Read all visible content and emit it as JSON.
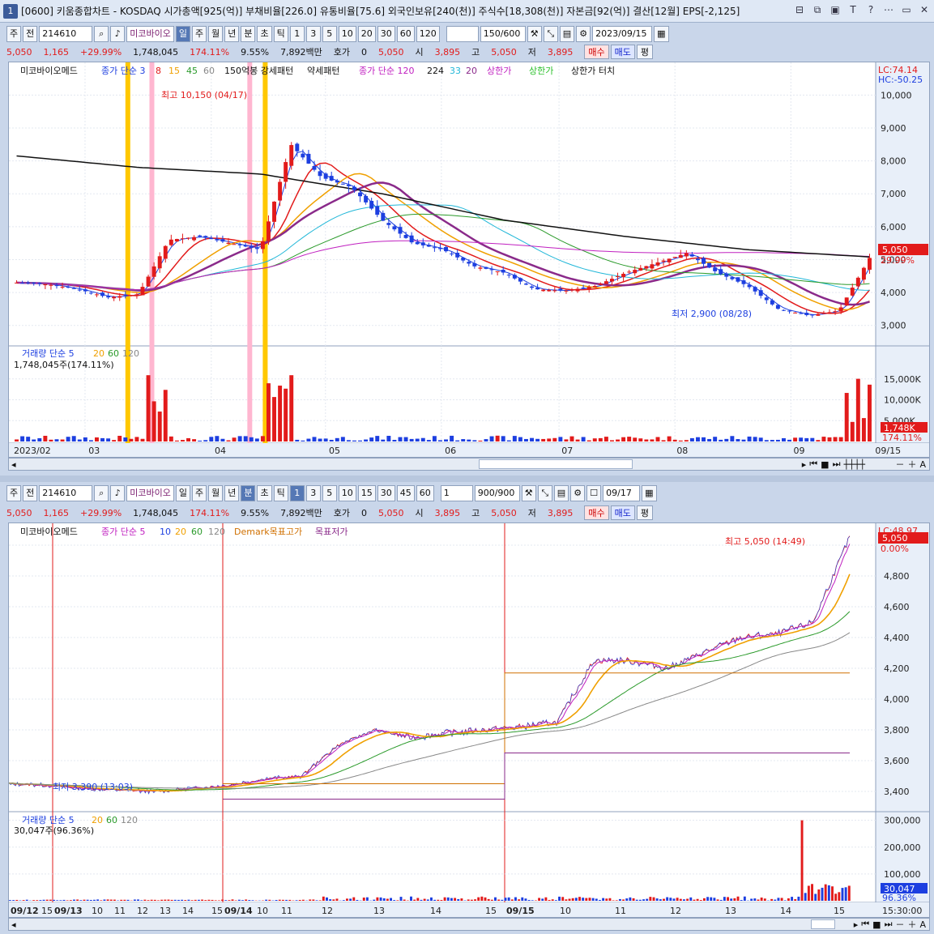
{
  "window": {
    "number": "1",
    "title": "[0600] 키움종합차트 - KOSDAQ 시가총액[925(억)] 부채비율[226.0] 유통비율[75.6] 외국인보유[240(천)] 주식수[18,308(천)] 자본금[92(억)] 결산[12월] EPS[-2,125]",
    "buttons": [
      "⊟",
      "⧉",
      "▣",
      "T",
      "?",
      "⋯",
      "▭",
      "✕"
    ]
  },
  "top": {
    "toolbar": {
      "type": "주",
      "prev": "전",
      "code": "214610",
      "name": "미코바이오",
      "periods": [
        "일",
        "주",
        "월",
        "년",
        "분",
        "초",
        "틱"
      ],
      "active_period": "일",
      "counts": [
        "1",
        "3",
        "5",
        "10",
        "20",
        "30",
        "60",
        "120"
      ],
      "range": "150/600",
      "date": "2023/09/15"
    },
    "info": {
      "price": "5,050",
      "change": "1,165",
      "pct": "+29.99%",
      "volume": "1,748,045",
      "vol_pct": "174.11%",
      "turnover": "9.55%",
      "amount": "7,892백만",
      "quote_label": "호가",
      "quote_val": "0",
      "quote_price": "5,050",
      "open_label": "시",
      "open": "3,895",
      "high_label": "고",
      "high": "5,050",
      "low_label": "저",
      "low": "3,895",
      "buy": "매수",
      "sell": "매도",
      "avg": "평"
    },
    "legend": [
      "미코바이오메드",
      "종가 단순 3",
      "8",
      "15",
      "45",
      "60",
      "150억봉 강세패턴",
      "약세패턴",
      "종가 단순 120",
      "224",
      "33",
      "20",
      "상한가",
      "상한가",
      "상한가 터치"
    ],
    "right_top": [
      "LC:74.14",
      "HC:-50.25"
    ],
    "hi_label": "최고 10,150 (04/17)",
    "lo_label": "최저 2,900 (08/28)",
    "price_badge": "5,050",
    "pct_badge": "29.99%",
    "vol_legend": [
      "거래량 단순 5",
      "20",
      "60",
      "120"
    ],
    "vol_text": "1,748,045주(174.11%)",
    "vol_badge": "1,748K",
    "vol_pct_badge": "174.11%",
    "x_labels": [
      "2023/02",
      "03",
      "04",
      "05",
      "06",
      "07",
      "08",
      "09",
      "09/15"
    ]
  },
  "bottom": {
    "toolbar": {
      "type": "주",
      "prev": "전",
      "code": "214610",
      "name": "미코바이오",
      "periods": [
        "일",
        "주",
        "월",
        "년",
        "분",
        "초",
        "틱"
      ],
      "active_period": "분",
      "counts": [
        "1",
        "3",
        "5",
        "10",
        "15",
        "30",
        "45",
        "60"
      ],
      "active_count": "1",
      "sel": "1",
      "range": "900/900",
      "date": "09/17"
    },
    "info": {
      "price": "5,050",
      "change": "1,165",
      "pct": "+29.99%",
      "volume": "1,748,045",
      "vol_pct": "174.11%",
      "turnover": "9.55%",
      "amount": "7,892백만",
      "quote_label": "호가",
      "quote_val": "0",
      "quote_price": "5,050",
      "open_label": "시",
      "open": "3,895",
      "high_label": "고",
      "high": "5,050",
      "low_label": "저",
      "low": "3,895",
      "buy": "매수",
      "sell": "매도",
      "avg": "평"
    },
    "legend": [
      "미코바이오메드",
      "종가 단순 5",
      "10",
      "20",
      "60",
      "120",
      "Demark목표고가",
      "목표저가"
    ],
    "right_top": [
      "LC:48.97"
    ],
    "hi_label": "최고 5,050 (14:49)",
    "lo_label": "최저 3,390 (13:03)",
    "price_badge": "5,050",
    "pct_badge": "0.00%",
    "vol_legend": [
      "거래량 단순 5",
      "20",
      "60",
      "120"
    ],
    "vol_text": "30,047주(96.36%)",
    "vol_badge": "30,047",
    "vol_pct_badge": "96.36%",
    "x_labels": [
      "09/12",
      "15",
      "09/13",
      "10",
      "11",
      "12",
      "13",
      "14",
      "15",
      "09/14",
      "10",
      "11",
      "12",
      "13",
      "14",
      "15",
      "09/15",
      "10",
      "11",
      "12",
      "13",
      "14",
      "15",
      "15:30:00"
    ]
  },
  "chart_data": [
    {
      "type": "candlestick",
      "title": "미코바이오메드 일봉",
      "x": [
        "2023/02",
        "03",
        "04",
        "05",
        "06",
        "07",
        "08",
        "09"
      ],
      "y_ticks": [
        3000,
        4000,
        5000,
        6000,
        7000,
        8000,
        9000,
        10000
      ],
      "ylim": [
        2500,
        10500
      ],
      "close_approx": [
        4300,
        4250,
        4100,
        3850,
        3950,
        5600,
        5700,
        5500,
        5300,
        8500,
        7500,
        7200,
        6200,
        5500,
        5300,
        4800,
        4600,
        4100,
        4050,
        4200,
        4600,
        4900,
        5200,
        4600,
        4200,
        3500,
        3300,
        3450,
        5050
      ],
      "high": 10150,
      "high_date": "04/17",
      "low": 2900,
      "low_date": "08/28",
      "last": 5050,
      "change_pct": 29.99,
      "volume_ticks": [
        5000,
        10000,
        15000
      ],
      "volume_unit": "K",
      "last_volume": 1748
    },
    {
      "type": "line",
      "title": "미코바이오메드 1분봉",
      "x": [
        "09/12",
        "09/13",
        "09/14",
        "09/15"
      ],
      "y_ticks": [
        3400,
        3600,
        3800,
        4000,
        4200,
        4400,
        4600,
        4800,
        5000
      ],
      "ylim": [
        3300,
        5100
      ],
      "close_approx": [
        3450,
        3440,
        3420,
        3410,
        3400,
        3420,
        3440,
        3480,
        3500,
        3700,
        3800,
        3750,
        3780,
        3800,
        3820,
        3850,
        4250,
        4250,
        4200,
        4300,
        4400,
        4420,
        4500,
        5050
      ],
      "high": 5050,
      "high_time": "14:49",
      "low": 3390,
      "low_time": "13:03",
      "demark_high": [
        3450,
        4170
      ],
      "demark_low": [
        3350,
        3650
      ],
      "volume_ticks": [
        100000,
        200000,
        300000
      ],
      "last_volume": 30047
    }
  ]
}
